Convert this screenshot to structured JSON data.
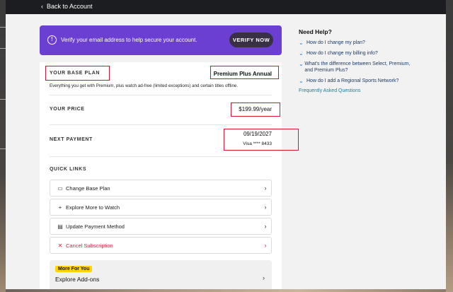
{
  "header": {
    "back_label": "Back to Account"
  },
  "banner": {
    "message": "Verify your email address to help secure your account.",
    "button_label": "VERIFY NOW"
  },
  "plan": {
    "base_plan_label": "YOUR BASE PLAN",
    "base_plan_value": "Premium Plus Annual",
    "description": "Everything you get with Premium, plus watch ad-free (limited exceptions) and certain titles offline.",
    "price_label": "YOUR PRICE",
    "price_value": "$199.99/year",
    "next_payment_label": "NEXT PAYMENT",
    "next_payment_date": "09/19/2027",
    "payment_method": "Visa **** 8433"
  },
  "quick_links": {
    "title": "QUICK LINKS",
    "items": [
      {
        "label": "Change Base Plan",
        "icon": "folder-icon"
      },
      {
        "label": "Explore More to Watch",
        "icon": "plus-icon"
      },
      {
        "label": "Update Payment Method",
        "icon": "card-icon"
      },
      {
        "label": "Cancel Subscription",
        "icon": "x-icon"
      }
    ]
  },
  "addons": {
    "badge": "More For You",
    "title": "Explore Add-ons"
  },
  "help": {
    "title": "Need Help?",
    "items": [
      "How do I change my plan?",
      "How do I change my billing info?",
      "What's the difference between Select, Premium, and Premium Plus?",
      "How do I add a Regional Sports Network?"
    ],
    "faq_link": "Frequently Asked Questions"
  },
  "colors": {
    "banner": "#6b3fd1",
    "highlight_box": "#e0132c",
    "badge": "#ffd400",
    "cancel": "#d4213b"
  }
}
